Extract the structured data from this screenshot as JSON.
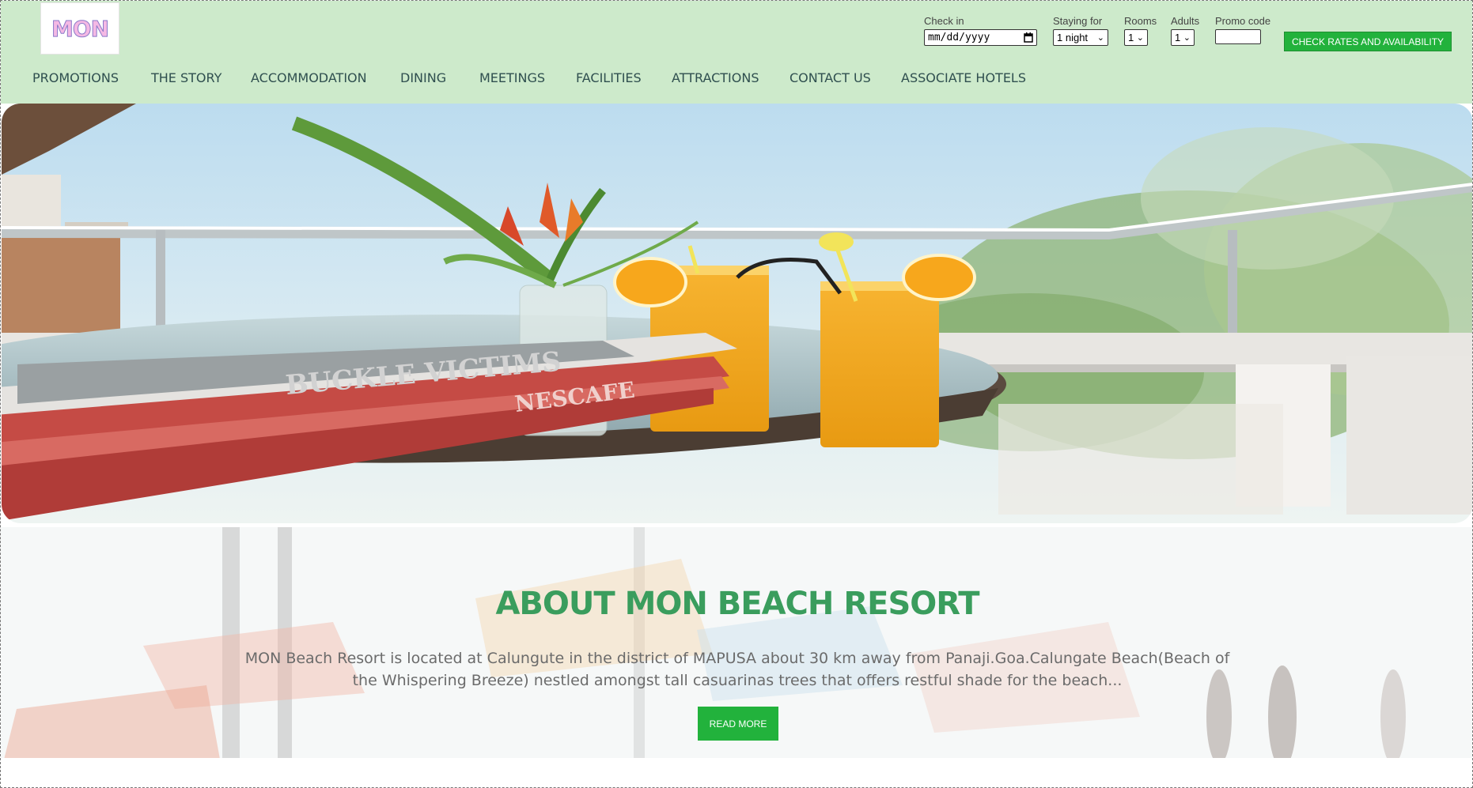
{
  "brand": {
    "logo_text": "MON"
  },
  "booking": {
    "checkin_label": "Check in",
    "checkin_placeholder": "mm/dd/yyyy",
    "staying_label": "Staying for",
    "staying_value": "1 night",
    "rooms_label": "Rooms",
    "rooms_value": "1",
    "adults_label": "Adults",
    "adults_value": "1",
    "promo_label": "Promo code",
    "promo_value": "",
    "check_button": "CHECK RATES AND AVAILABILITY"
  },
  "nav": {
    "items": [
      {
        "label": "PROMOTIONS"
      },
      {
        "label": "THE STORY"
      },
      {
        "label": "ACCOMMODATION"
      },
      {
        "label": "DINING"
      },
      {
        "label": "MEETINGS"
      },
      {
        "label": "FACILITIES"
      },
      {
        "label": "ATTRACTIONS"
      },
      {
        "label": "CONTACT US"
      },
      {
        "label": "ASSOCIATE HOTELS"
      }
    ]
  },
  "hero": {
    "newspaper_headline": "BUCKLE VICTIMS",
    "newspaper_brand": "NESCAFE"
  },
  "about": {
    "title": "ABOUT MON BEACH RESORT",
    "text": "MON Beach Resort is located at Calungute in the district of MAPUSA about 30 km away from Panaji.Goa.Calungate Beach(Beach of the Whispering Breeze) nestled amongst tall casuarinas trees that offers restful shade for the beach...",
    "read_more": "READ MORE"
  },
  "colors": {
    "header_bg": "#cdeacb",
    "accent_green": "#22b23c",
    "title_green": "#3a9d5d",
    "nav_text": "#2f4f4f"
  },
  "icons": {
    "calendar": "calendar-icon",
    "select_caret": "chevron-down-icon"
  }
}
